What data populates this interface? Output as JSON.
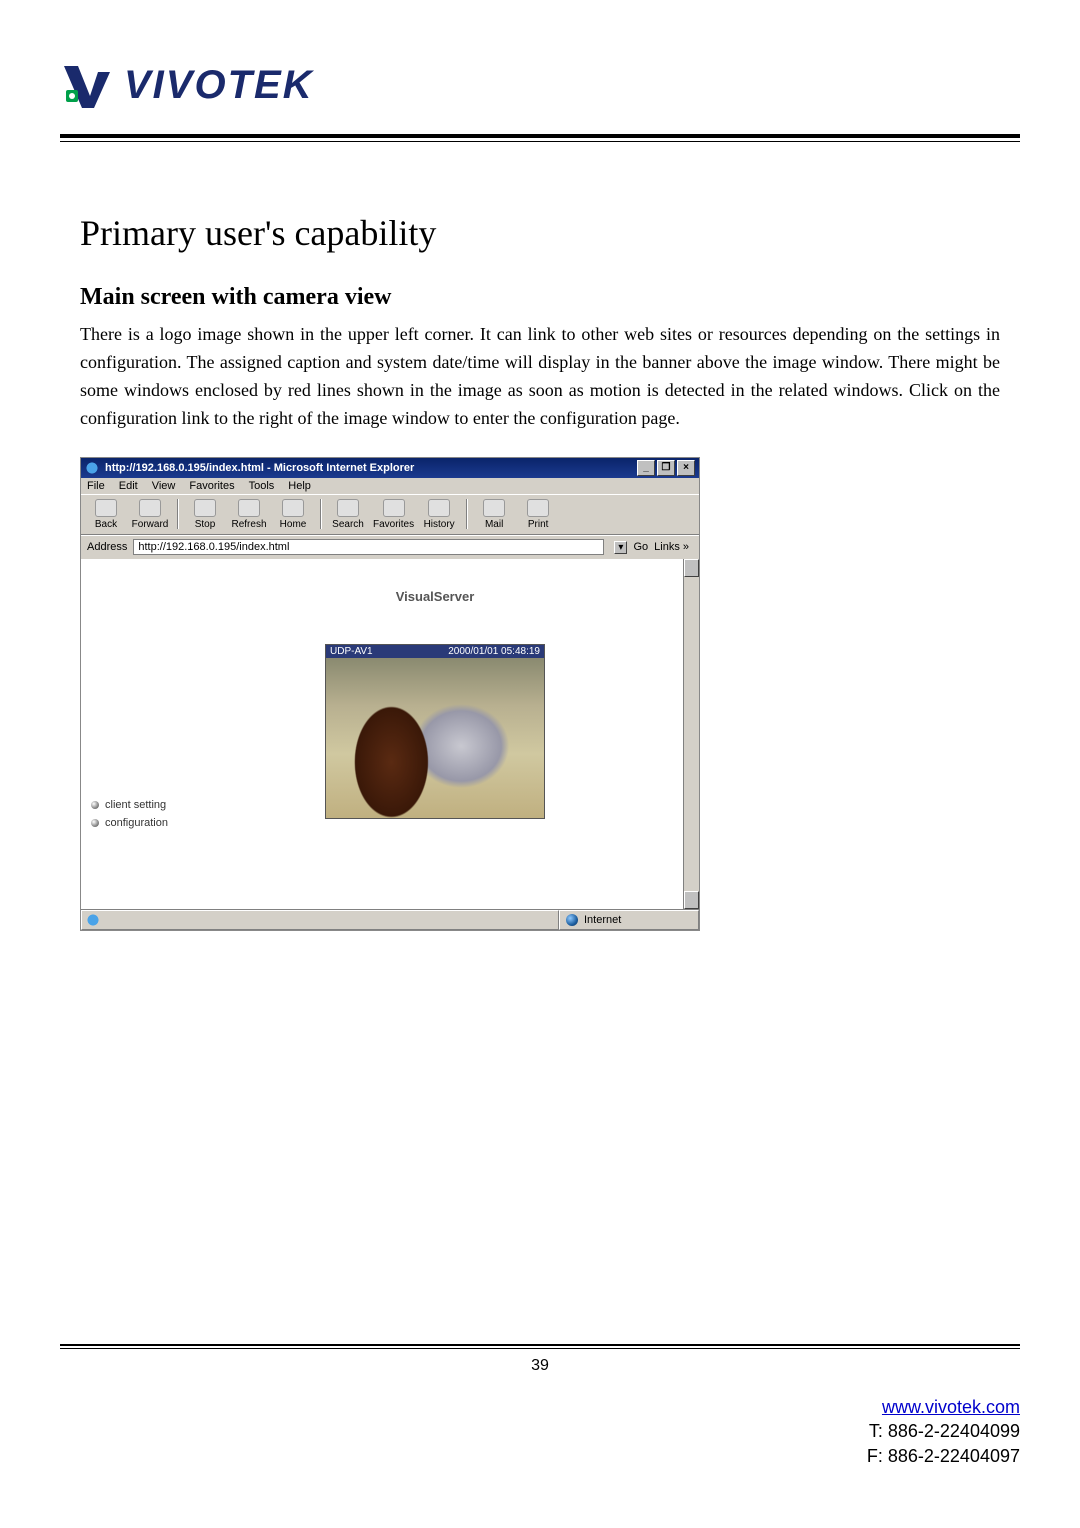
{
  "brand": {
    "name": "VIVOTEK"
  },
  "heading": "Primary user's capability",
  "subheading": "Main screen with camera view",
  "paragraph": "There is a logo image shown in the upper left corner. It can link to other web sites or resources depending on the settings in configuration. The assigned caption and system date/time will display in the banner above the image window. There might be some windows enclosed by red lines shown in the image as soon as motion is detected in the related windows. Click on the configuration link to the right of the image window to enter the configuration page.",
  "browser": {
    "title": "http://192.168.0.195/index.html - Microsoft Internet Explorer",
    "menu": {
      "file": "File",
      "edit": "Edit",
      "view": "View",
      "favorites": "Favorites",
      "tools": "Tools",
      "help": "Help"
    },
    "toolbar": {
      "back": "Back",
      "forward": "Forward",
      "stop": "Stop",
      "refresh": "Refresh",
      "home": "Home",
      "search": "Search",
      "favorites": "Favorites",
      "history": "History",
      "mail": "Mail",
      "print": "Print"
    },
    "address_label": "Address",
    "address_value": "http://192.168.0.195/index.html",
    "go_label": "Go",
    "links_label": "Links »",
    "status_zone": "Internet",
    "win": {
      "min": "_",
      "max": "❐",
      "close": "×"
    }
  },
  "visualserver": {
    "title": "VisualServer",
    "banner_left": "UDP-AV1",
    "banner_right": "2000/01/01 05:48:19",
    "nav": {
      "client_setting": "client setting",
      "configuration": "configuration"
    }
  },
  "footer": {
    "page_number": "39",
    "url": "www.vivotek.com",
    "tel": "T: 886-2-22404099",
    "fax": "F: 886-2-22404097"
  }
}
